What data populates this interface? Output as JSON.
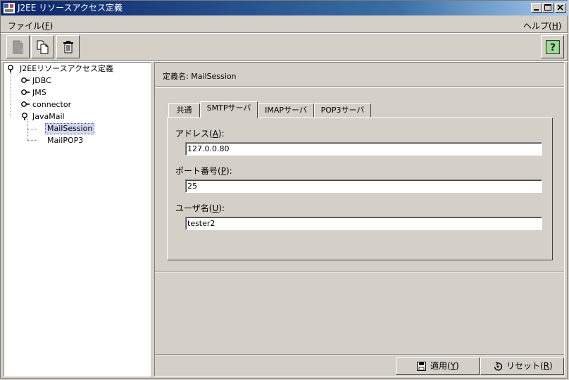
{
  "window": {
    "title": "J2EE リソースアクセス定義"
  },
  "menu": {
    "file": {
      "text": "ファイル(",
      "key": "F",
      "end": ")"
    },
    "help": {
      "text": "ヘルプ(",
      "key": "H",
      "end": ")"
    }
  },
  "toolbar": {
    "new_icon": "new-document-icon",
    "copy_icon": "copy-icon",
    "delete_icon": "trash-icon",
    "help_icon": "help-icon"
  },
  "tree": {
    "root": "J2EEリソースアクセス定義",
    "nodes": [
      "JDBC",
      "JMS",
      "connector",
      "JavaMail"
    ],
    "leaves": [
      "MailSession",
      "MailPOP3"
    ],
    "selected": "MailSession"
  },
  "definition": {
    "label": "定義名: ",
    "value": "MailSession"
  },
  "tabs": [
    "共通",
    "SMTPサーバ",
    "IMAPサーバ",
    "POP3サーバ"
  ],
  "active_tab": "SMTPサーバ",
  "form": {
    "address": {
      "label": "アドレス(",
      "key": "A",
      "end": "):",
      "value": "127.0.0.80"
    },
    "port": {
      "label": "ポート番号(",
      "key": "P",
      "end": "):",
      "value": "25"
    },
    "user": {
      "label": "ユーザ名(",
      "key": "U",
      "end": "):",
      "value": "tester2"
    }
  },
  "buttons": {
    "apply": {
      "text": "適用(",
      "key": "Y",
      "end": ")"
    },
    "reset": {
      "text": "リセット(",
      "key": "R",
      "end": ")"
    }
  }
}
